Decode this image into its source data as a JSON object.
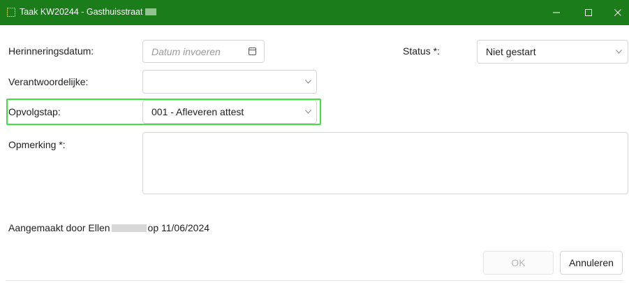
{
  "window": {
    "title": "Taak KW20244 - Gasthuisstraat",
    "controls": [
      "minimize-icon",
      "maximize-icon",
      "close-icon"
    ]
  },
  "form": {
    "herinneringsdatum": {
      "label": "Herinneringsdatum:",
      "placeholder": "Datum invoeren",
      "icon": "calendar-icon"
    },
    "status": {
      "label": "Status *:",
      "value": "Niet gestart"
    },
    "verantwoordelijke": {
      "label": "Verantwoordelijke:",
      "value": ""
    },
    "opvolgstap": {
      "label": "Opvolgstap:",
      "value": "001 - Afleveren attest"
    },
    "opmerking": {
      "label": "Opmerking *:",
      "value": ""
    }
  },
  "footer": {
    "created_prefix": "Aangemaakt door Ellen",
    "created_suffix": "op 11/06/2024"
  },
  "buttons": {
    "ok": "OK",
    "cancel": "Annuleren"
  },
  "colors": {
    "titlebar": "#1a7d1a",
    "highlight": "#40e040"
  }
}
